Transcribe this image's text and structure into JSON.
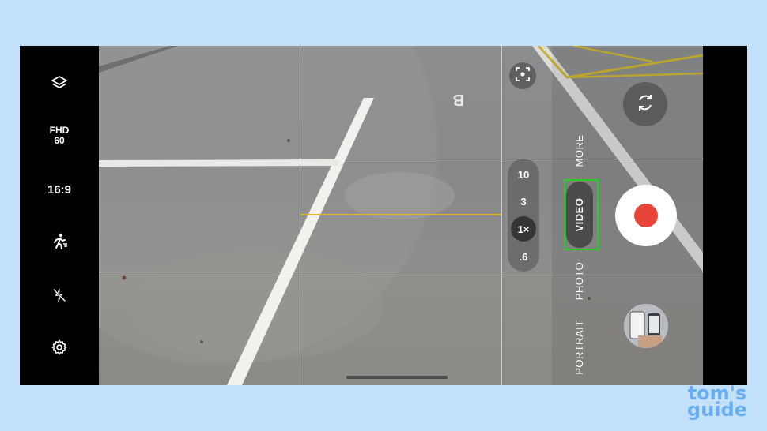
{
  "left_rail": {
    "items": [
      {
        "icon": "layers-icon"
      },
      {
        "resolution": "FHD",
        "fps": "60"
      },
      {
        "aspect_ratio": "16:9"
      },
      {
        "icon": "motion-running-icon"
      },
      {
        "icon": "flash-off-icon"
      },
      {
        "icon": "gear-icon"
      }
    ]
  },
  "zoom": {
    "options": [
      "10",
      "3",
      "1×",
      ".6"
    ],
    "selected": "1×"
  },
  "modes": {
    "more": "MORE",
    "video": "VIDEO",
    "photo": "PHOTO",
    "portrait": "PORTRAIT",
    "selected": "VIDEO"
  },
  "viewfinder": {
    "ground_marking": "B"
  },
  "colors": {
    "record": "#e8453a",
    "highlight": "#22d122",
    "level_line": "#d9b62a",
    "background": "#c4e1fb",
    "brand": "#6aaef0"
  },
  "watermark": {
    "line1": "tom's",
    "line2": "guide"
  }
}
